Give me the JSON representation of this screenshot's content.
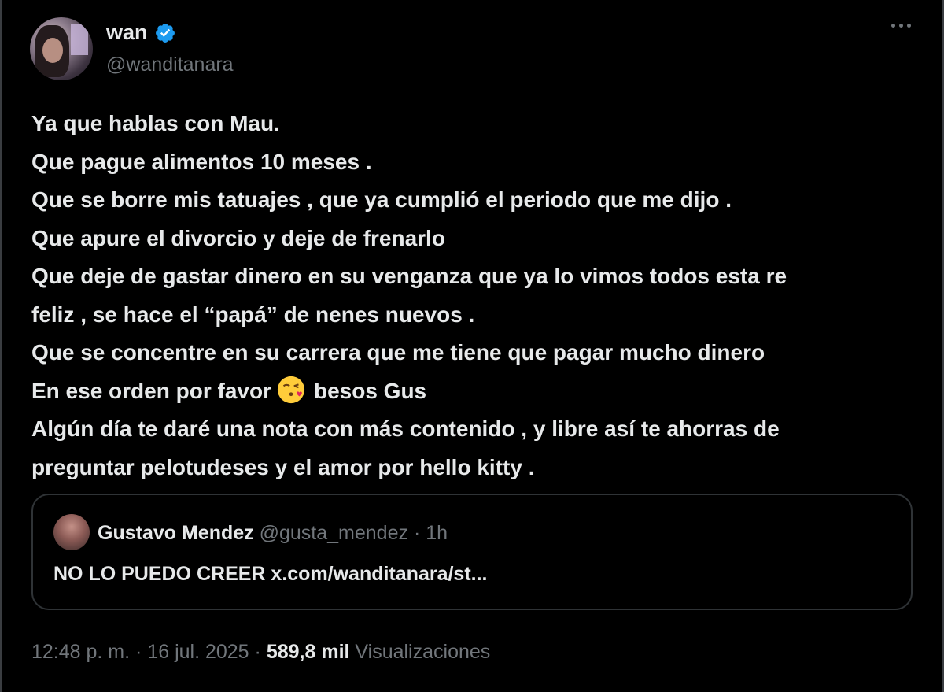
{
  "author": {
    "display_name": "wan",
    "handle": "@wanditanara",
    "verified_color": "#1d9bf0"
  },
  "tweet": {
    "lines": [
      "Ya que hablas con Mau.",
      "Que pague alimentos 10 meses .",
      "Que se borre mis tatuajes , que ya cumplió el periodo que me dijo .",
      "Que apure el divorcio y deje de frenarlo",
      "Que deje de gastar dinero en su venganza que ya lo vimos todos esta re",
      "feliz , se hace el “papá” de nenes nuevos .",
      "Que se concentre en su carrera que me tiene que pagar mucho dinero",
      "En ese orden por favor",
      "besos Gus",
      "Algún día te daré una nota con más contenido , y libre así te ahorras de",
      "preguntar pelotudeses y el amor por hello kitty ."
    ],
    "emoji": "face-blowing-a-kiss"
  },
  "quote": {
    "name": "Gustavo Mendez",
    "handle": "@gusta_mendez",
    "separator": "·",
    "time": "1h",
    "text": "NO LO PUEDO CREER x.com/wanditanara/st..."
  },
  "footer": {
    "time": "12:48 p. m.",
    "separator": "·",
    "date": "16 jul. 2025",
    "views_count": "589,8 mil",
    "views_label": "Visualizaciones"
  },
  "colors": {
    "background": "#000000",
    "text": "#e7e9ea",
    "secondary": "#71767b",
    "border": "#2f3336",
    "verified": "#1d9bf0"
  }
}
